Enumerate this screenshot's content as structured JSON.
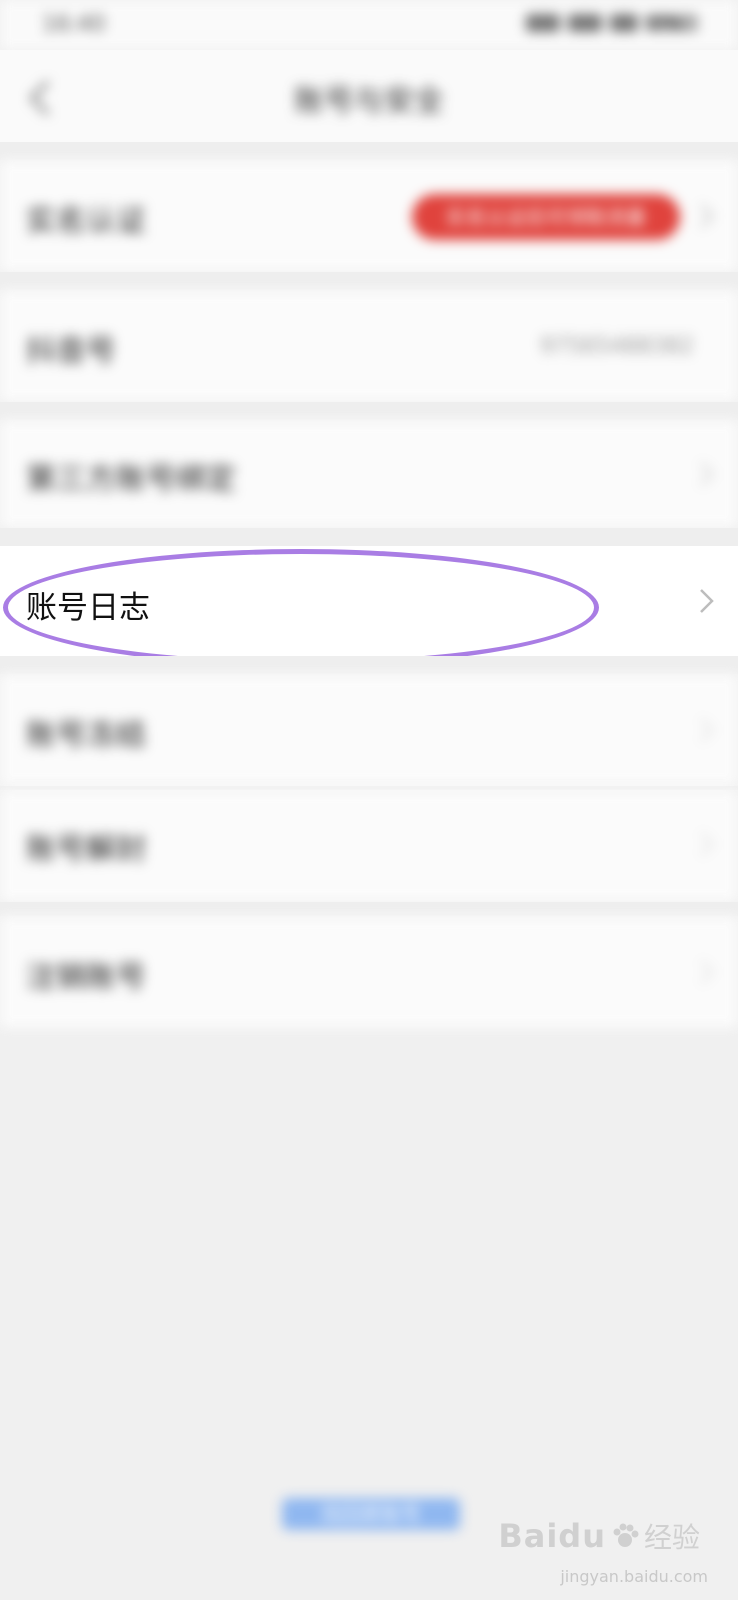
{
  "status_bar": {
    "time": "16:40",
    "right_text": "57%"
  },
  "nav": {
    "title": "账号与安全"
  },
  "rows": {
    "real_name": {
      "label": "实名认证",
      "badge": "实名认证后可领取流量"
    },
    "account_id": {
      "label": "抖音号",
      "value": "97565488382"
    },
    "third_party": {
      "label": "第三方账号绑定"
    },
    "account_log": {
      "label": "账号日志"
    },
    "freeze": {
      "label": "账号冻结"
    },
    "unbind": {
      "label": "账号解封"
    },
    "cancel": {
      "label": "注销账号"
    }
  },
  "bottom": {
    "link_text": "找回原账号"
  },
  "watermark": {
    "brand": "Baidu",
    "sub": "经验",
    "url": "jingyan.baidu.com"
  },
  "colors": {
    "highlight": "#a97de4",
    "badge": "#e0433d"
  }
}
